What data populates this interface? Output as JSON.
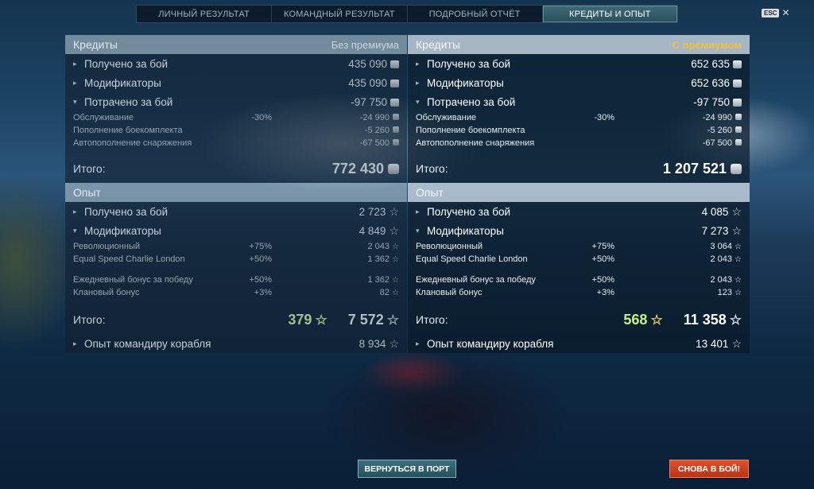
{
  "tabs": [
    {
      "label": "ЛИЧНЫЙ РЕЗУЛЬТАТ",
      "active": false
    },
    {
      "label": "КОМАНДНЫЙ РЕЗУЛЬТАТ",
      "active": false
    },
    {
      "label": "ПОДРОБНЫЙ ОТЧЁТ",
      "active": false
    },
    {
      "label": "КРЕДИТЫ И ОПЫТ",
      "active": true
    }
  ],
  "esc": {
    "label": "ESC",
    "close": "✕"
  },
  "left": {
    "credits": {
      "title": "Кредиты",
      "subtitle": "Без премиума",
      "earned": {
        "label": "Получено за бой",
        "value": "435 090"
      },
      "modifiers": {
        "label": "Модификаторы",
        "value": "435 090"
      },
      "spent": {
        "label": "Потрачено за бой",
        "value": "-97 750"
      },
      "details": [
        {
          "label": "Обслуживание",
          "pct": "-30%",
          "value": "-24 990"
        },
        {
          "label": "Пополнение боекомплекта",
          "pct": "",
          "value": "-5 260"
        },
        {
          "label": "Автопополнение снаряжения",
          "pct": "",
          "value": "-67 500"
        }
      ],
      "total_label": "Итого:",
      "total_value": "772 430"
    },
    "exp": {
      "title": "Опыт",
      "earned": {
        "label": "Получено за бой",
        "value": "2 723"
      },
      "modifiers": {
        "label": "Модификаторы",
        "value": "4 849"
      },
      "details_a": [
        {
          "label": "Революционный",
          "pct": "+75%",
          "value": "2 043"
        },
        {
          "label": "Equal Speed Charlie London",
          "pct": "+50%",
          "value": "1 362"
        }
      ],
      "details_b": [
        {
          "label": "Ежедневный бонус за победу",
          "pct": "+50%",
          "value": "1 362"
        },
        {
          "label": "Клановый бонус",
          "pct": "+3%",
          "value": "82"
        }
      ],
      "total_label": "Итого:",
      "free_value": "379",
      "total_value": "7 572",
      "commander": {
        "label": "Опыт командиру корабля",
        "value": "8 934"
      }
    }
  },
  "right": {
    "credits": {
      "title": "Кредиты",
      "subtitle": "С премиумом",
      "earned": {
        "label": "Получено за бой",
        "value": "652 635"
      },
      "modifiers": {
        "label": "Модификаторы",
        "value": "652 636"
      },
      "spent": {
        "label": "Потрачено за бой",
        "value": "-97 750"
      },
      "details": [
        {
          "label": "Обслуживание",
          "pct": "-30%",
          "value": "-24 990"
        },
        {
          "label": "Пополнение боекомплекта",
          "pct": "",
          "value": "-5 260"
        },
        {
          "label": "Автопополнение снаряжения",
          "pct": "",
          "value": "-67 500"
        }
      ],
      "total_label": "Итого:",
      "total_value": "1 207 521"
    },
    "exp": {
      "title": "Опыт",
      "earned": {
        "label": "Получено за бой",
        "value": "4 085"
      },
      "modifiers": {
        "label": "Модификаторы",
        "value": "7 273"
      },
      "details_a": [
        {
          "label": "Революционный",
          "pct": "+75%",
          "value": "3 064"
        },
        {
          "label": "Equal Speed Charlie London",
          "pct": "+50%",
          "value": "2 043"
        }
      ],
      "details_b": [
        {
          "label": "Ежедневный бонус за победу",
          "pct": "+50%",
          "value": "2 043"
        },
        {
          "label": "Клановый бонус",
          "pct": "+3%",
          "value": "123"
        }
      ],
      "total_label": "Итого:",
      "free_value": "568",
      "total_value": "11 358",
      "commander": {
        "label": "Опыт командиру корабля",
        "value": "13 401"
      }
    }
  },
  "buttons": {
    "port": "ВЕРНУТЬСЯ В ПОРТ",
    "battle": "СНОВА В БОЙ!"
  },
  "icons": {
    "collapsed": "▸",
    "expanded": "▾",
    "star": "☆"
  },
  "colors": {
    "premium": "#f2c23a",
    "battle_button": "#d84424",
    "port_button": "#33636f",
    "free_exp_green": "#c6f08a"
  }
}
